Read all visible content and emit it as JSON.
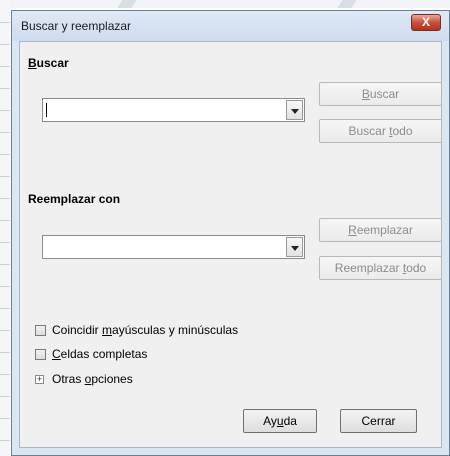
{
  "window": {
    "title": "Buscar y reemplazar",
    "close_label": "X"
  },
  "search": {
    "label_accel": "B",
    "label_rest": "uscar",
    "value": "",
    "find_button": {
      "pre": "",
      "accel": "B",
      "post": "uscar"
    },
    "find_all_button": {
      "pre": "Buscar ",
      "accel": "t",
      "post": "odo"
    }
  },
  "replace": {
    "label": "Reemplazar con",
    "value": "",
    "replace_button": {
      "pre": "",
      "accel": "R",
      "post": "eemplazar"
    },
    "replace_all_button": {
      "pre": "Reemplazar ",
      "accel": "t",
      "post": "odo"
    }
  },
  "options": {
    "match_case": {
      "pre": "Coincidir ",
      "accel": "m",
      "post": "ayúsculas y minúsculas",
      "checked": false
    },
    "whole_cells": {
      "pre": "",
      "accel": "C",
      "post": "eldas completas",
      "checked": false
    },
    "more_options": {
      "pre": "Otras ",
      "accel": "o",
      "post": "pciones",
      "expander": "+"
    }
  },
  "footer": {
    "help_button": {
      "pre": "Ay",
      "accel": "u",
      "post": "da"
    },
    "close_button": "Cerrar"
  }
}
